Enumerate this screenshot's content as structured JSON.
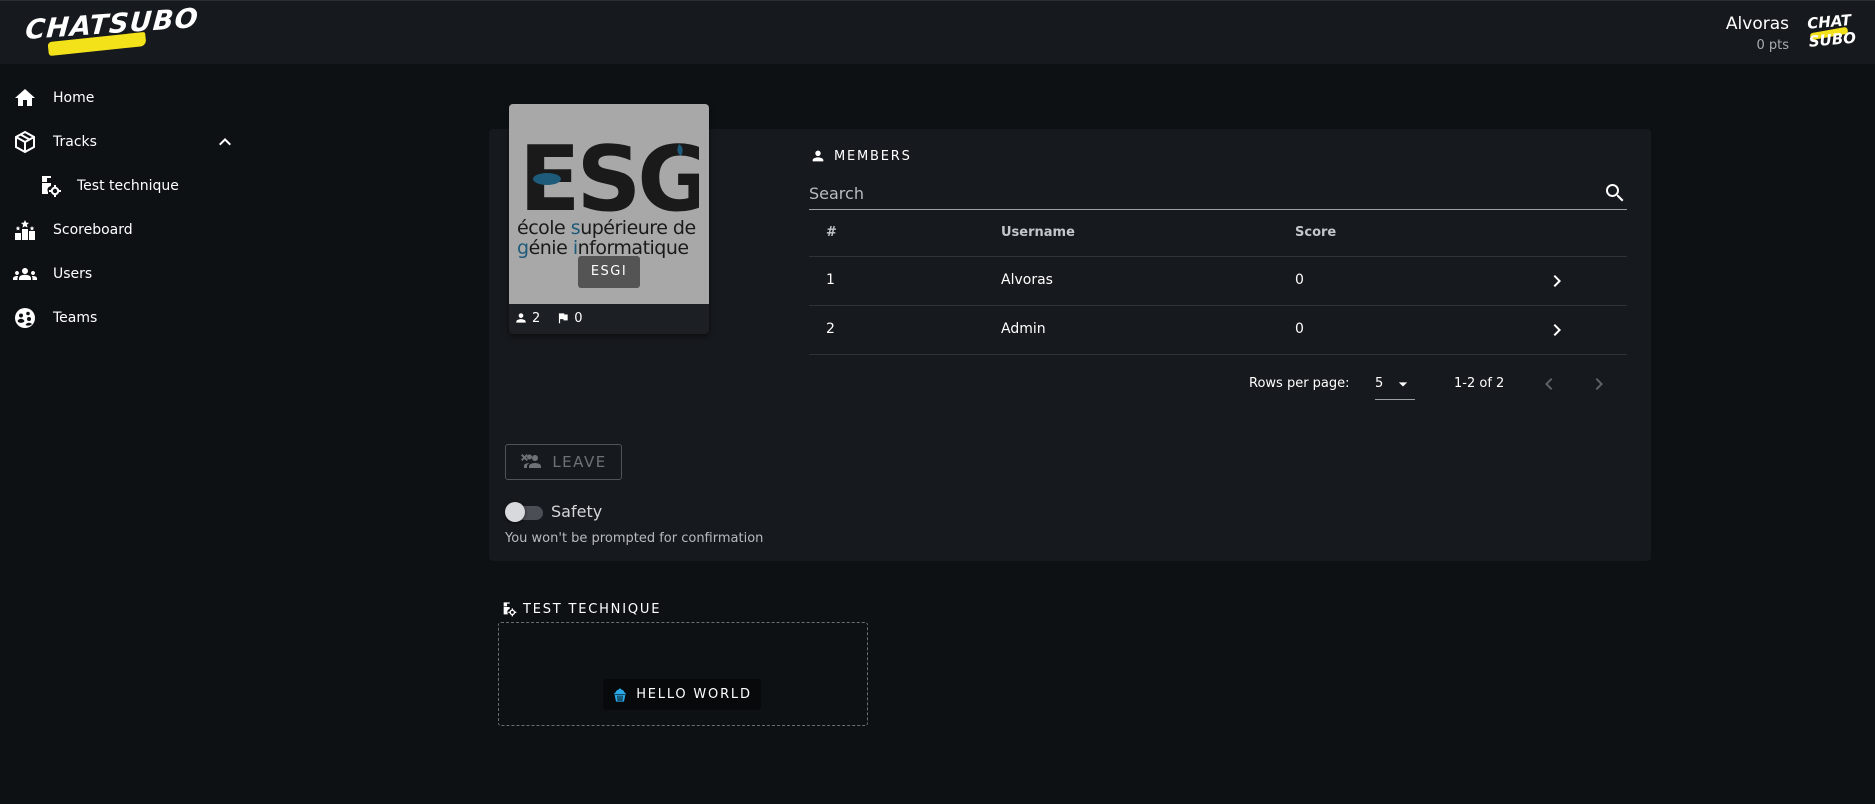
{
  "brand": {
    "logo_text": "CHATSUBO",
    "avatar_text_top": "CHAT",
    "avatar_text_bottom": "SUBO",
    "accent": "#f3e21a"
  },
  "user": {
    "name": "Alvoras",
    "points": "0 pts"
  },
  "sidebar": {
    "items": [
      {
        "label": "Home",
        "icon": "home-icon"
      },
      {
        "label": "Tracks",
        "icon": "tracks-cube-icon",
        "expanded": true
      },
      {
        "label": "Test technique",
        "icon": "track-settings-icon"
      },
      {
        "label": "Scoreboard",
        "icon": "scoreboard-icon"
      },
      {
        "label": "Users",
        "icon": "users-icon"
      },
      {
        "label": "Teams",
        "icon": "teams-icon"
      }
    ]
  },
  "team": {
    "chip": "ESGI",
    "logo_letters": "ESGI",
    "logo_line1_a": "école ",
    "logo_line1_b": "s",
    "logo_line1_c": "upérieure de",
    "logo_line2_a": "g",
    "logo_line2_b": "énie ",
    "logo_line2_c": "i",
    "logo_line2_d": "nformatique",
    "members_count": "2",
    "flags_count": "0"
  },
  "members": {
    "title": "MEMBERS",
    "search_placeholder": "Search",
    "columns": [
      "#",
      "Username",
      "Score"
    ],
    "rows": [
      {
        "rank": "1",
        "username": "Alvoras",
        "score": "0"
      },
      {
        "rank": "2",
        "username": "Admin",
        "score": "0"
      }
    ],
    "pager": {
      "rows_per_page_label": "Rows per page:",
      "rows_per_page": "5",
      "range": "1-2 of 2"
    }
  },
  "actions": {
    "leave_label": "LEAVE",
    "safety_label": "Safety",
    "safety_on": false,
    "safety_hint": "You won't be prompted for confirmation"
  },
  "track": {
    "title": "TEST TECHNIQUE",
    "challenges": [
      {
        "label": "HELLO WORLD",
        "icon": "cupcake-icon",
        "icon_color": "#29a8e6"
      }
    ]
  }
}
